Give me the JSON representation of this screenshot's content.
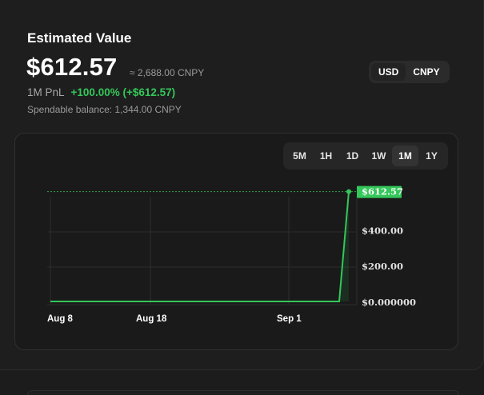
{
  "card": {
    "title": "Estimated Value",
    "value": "$612.57",
    "approx": "≈ 2,688.00 CNPY",
    "pnl_label": "1M PnL",
    "pnl_value": "+100.00% (+$612.57)",
    "spendable": "Spendable balance: 1,344.00 CNPY"
  },
  "currency_toggle": {
    "options": [
      "USD",
      "CNPY"
    ],
    "selected": "USD"
  },
  "range_tabs": {
    "options": [
      "5M",
      "1H",
      "1D",
      "1W",
      "1M",
      "1Y"
    ],
    "selected": "1M"
  },
  "colors": {
    "accent_green": "#34c759",
    "background": "#1c1c1c",
    "card": "#1e1e1e"
  },
  "chart_data": {
    "type": "line",
    "title": "",
    "xlabel": "",
    "ylabel": "",
    "x_ticks": [
      "Aug 8",
      "Aug 18",
      "Sep 1"
    ],
    "y_ticks": [
      "$0.000000",
      "$200.00",
      "$400.00"
    ],
    "current_value_label": "$612.57",
    "ylim": [
      0,
      620
    ],
    "grid": true,
    "series": [
      {
        "x": [
          "Aug 8",
          "Aug 13",
          "Aug 18",
          "Aug 23",
          "Aug 28",
          "Sep 1",
          "Sep 4",
          "Sep 5"
        ],
        "values": [
          0,
          0,
          0,
          0,
          0,
          0,
          0,
          612.57
        ]
      }
    ]
  }
}
